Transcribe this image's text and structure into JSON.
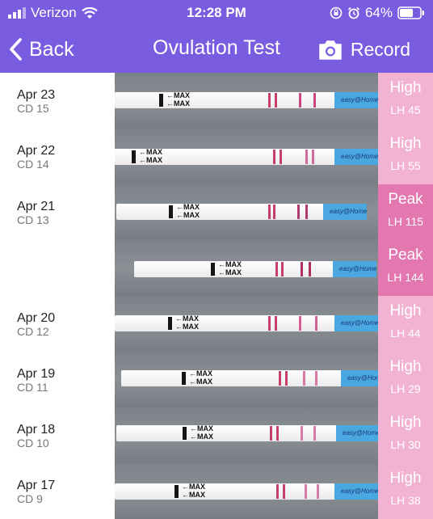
{
  "status_bar": {
    "carrier": "Verizon",
    "time": "12:28 PM",
    "battery": "64%"
  },
  "nav": {
    "back_label": "Back",
    "title": "Ovulation Test",
    "record_label": "Record"
  },
  "colors": {
    "accent": "#7a5ce0",
    "high": "#f2b3d3",
    "peak": "#e377b0"
  },
  "icons": {
    "back": "chevron-left-icon",
    "record": "camera-icon",
    "wifi": "wifi-icon",
    "signal": "signal-icon",
    "lock": "rotation-lock-icon",
    "alarm": "alarm-icon",
    "battery": "battery-icon"
  },
  "strip_text": {
    "max": "←MAX",
    "brand": "easy@Home"
  },
  "rows": [
    {
      "date": "Apr 23",
      "cd": "CD 15",
      "level": "High",
      "lh": "LH 45"
    },
    {
      "date": "Apr 22",
      "cd": "CD 14",
      "level": "High",
      "lh": "LH 55"
    },
    {
      "date": "Apr 21",
      "cd": "CD 13",
      "level": "Peak",
      "lh": "LH 115"
    },
    {
      "date": "",
      "cd": "",
      "level": "Peak",
      "lh": "LH 144"
    },
    {
      "date": "Apr 20",
      "cd": "CD 12",
      "level": "High",
      "lh": "LH 44"
    },
    {
      "date": "Apr 19",
      "cd": "CD 11",
      "level": "High",
      "lh": "LH 29"
    },
    {
      "date": "Apr 18",
      "cd": "CD 10",
      "level": "High",
      "lh": "LH 30"
    },
    {
      "date": "Apr 17",
      "cd": "CD 9",
      "level": "High",
      "lh": "LH 38"
    }
  ]
}
